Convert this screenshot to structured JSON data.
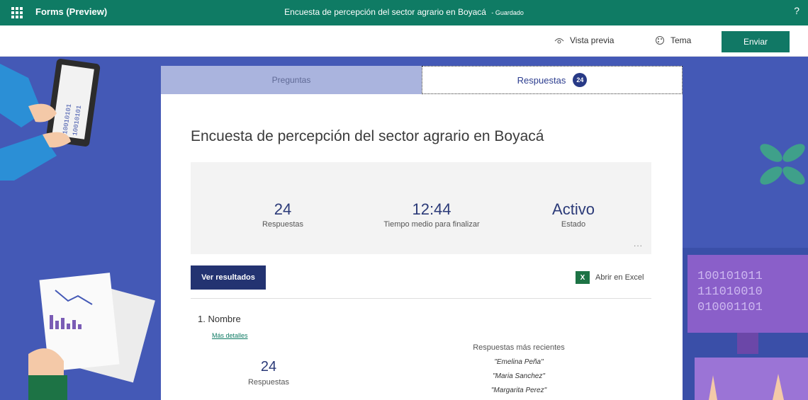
{
  "topbar": {
    "app_name": "Forms (Preview)",
    "title": "Encuesta de percepción del sector agrario en Boyacá",
    "saved": "- Guardado",
    "help": "?"
  },
  "command_bar": {
    "preview": "Vista previa",
    "theme": "Tema",
    "send": "Enviar"
  },
  "tabs": {
    "questions": "Preguntas",
    "responses": "Respuestas",
    "responses_badge": "24"
  },
  "form": {
    "title": "Encuesta de percepción del sector agrario en Boyacá"
  },
  "stats": [
    {
      "value": "24",
      "label": "Respuestas"
    },
    {
      "value": "12:44",
      "label": "Tiempo medio para finalizar"
    },
    {
      "value": "Activo",
      "label": "Estado"
    }
  ],
  "more": "...",
  "actions": {
    "view_results": "Ver resultados",
    "open_excel": "Abrir en Excel",
    "excel_glyph": "X"
  },
  "question1": {
    "title": "1. Nombre",
    "more_details": "Más detalles",
    "count_value": "24",
    "count_label": "Respuestas",
    "recent_title": "Respuestas más recientes",
    "recent": [
      "\"Emelina Peña\"",
      "\"Maria Sanchez\"",
      "\"Margarita Perez\""
    ]
  },
  "decor": {
    "binary_left_a": "10010101",
    "binary_left_b": "10010101",
    "binary_right": [
      "100101011",
      "111010010",
      "010001101"
    ]
  },
  "colors": {
    "brand_green": "#0f7b64",
    "background_blue": "#4459b6",
    "accent_navy": "#233371"
  }
}
